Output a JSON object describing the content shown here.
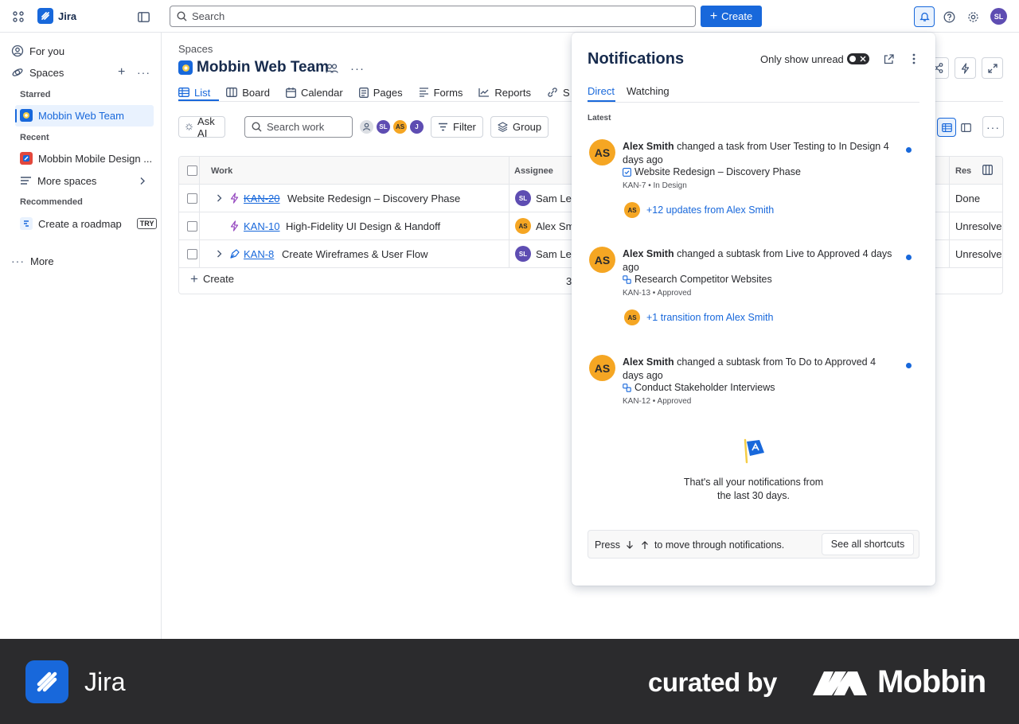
{
  "topbar": {
    "app_name": "Jira",
    "search_placeholder": "Search",
    "create_label": "Create",
    "user_initials": "SL"
  },
  "sidebar": {
    "for_you": "For you",
    "spaces": "Spaces",
    "starred_label": "Starred",
    "starred_item": "Mobbin Web Team",
    "recent_label": "Recent",
    "recent_item": "Mobbin Mobile Design ...",
    "more_spaces": "More spaces",
    "recommended_label": "Recommended",
    "roadmap": "Create a roadmap",
    "try_badge": "TRY",
    "more": "More"
  },
  "main": {
    "breadcrumb": "Spaces",
    "project_title": "Mobbin Web Team",
    "tabs": [
      {
        "label": "List",
        "icon": "list-icon"
      },
      {
        "label": "Board",
        "icon": "board-icon"
      },
      {
        "label": "Calendar",
        "icon": "calendar-icon"
      },
      {
        "label": "Pages",
        "icon": "pages-icon"
      },
      {
        "label": "Forms",
        "icon": "forms-icon"
      },
      {
        "label": "Reports",
        "icon": "reports-icon"
      },
      {
        "label": "S",
        "icon": "link-icon"
      }
    ],
    "toolbar": {
      "ask_ai": "Ask AI",
      "search_placeholder": "Search work",
      "assignees": [
        "SL",
        "AS",
        "J"
      ],
      "filter": "Filter",
      "group": "Group"
    },
    "table": {
      "columns": [
        "Work",
        "Assignee",
        "Res"
      ],
      "rows": [
        {
          "key": "KAN-20",
          "summary": "Website Redesign – Discovery Phase",
          "assignee": "Sam Lee",
          "initials": "SL",
          "resolution": "Done",
          "expandable": true,
          "done": true
        },
        {
          "key": "KAN-10",
          "summary": "High-Fidelity UI Design & Handoff",
          "assignee": "Alex Sm",
          "initials": "AS",
          "resolution": "Unresolved",
          "expandable": false,
          "done": false
        },
        {
          "key": "KAN-8",
          "summary": "Create Wireframes & User Flow",
          "assignee": "Sam Lee",
          "initials": "SL",
          "resolution": "Unresolved",
          "expandable": true,
          "done": false
        }
      ],
      "create_label": "Create",
      "count": "3"
    }
  },
  "notifications": {
    "title": "Notifications",
    "only_unread_label": "Only show unread",
    "tabs": [
      "Direct",
      "Watching"
    ],
    "section_label": "Latest",
    "items": [
      {
        "initials": "AS",
        "actor": "Alex Smith",
        "action": "changed a task from User Testing to In Design",
        "time": "4 days ago",
        "task": "Website Redesign – Discovery Phase",
        "meta": "KAN-7 • In Design",
        "more": "+12 updates from Alex Smith"
      },
      {
        "initials": "AS",
        "actor": "Alex Smith",
        "action": "changed a subtask from Live to Approved",
        "time": "4 days ago",
        "task": "Research Competitor Websites",
        "meta": "KAN-13 • Approved",
        "more": "+1 transition from Alex Smith"
      },
      {
        "initials": "AS",
        "actor": "Alex Smith",
        "action": "changed a subtask from To Do to Approved",
        "time": "4 days ago",
        "task": "Conduct Stakeholder Interviews",
        "meta": "KAN-12 • Approved",
        "more": ""
      }
    ],
    "end_line1": "That's all your notifications from",
    "end_line2": "the last 30 days.",
    "footer_press": "Press",
    "footer_move": "to move through notifications.",
    "footer_button": "See all shortcuts",
    "more_initials": "AS"
  },
  "banner": {
    "app_name": "Jira",
    "curated_by": "curated by",
    "brand": "Mobbin"
  },
  "colors": {
    "primary": "#1868db",
    "avatar_purple": "#5e4db2",
    "avatar_orange": "#f5a623",
    "banner_bg": "#2b2b2d"
  }
}
